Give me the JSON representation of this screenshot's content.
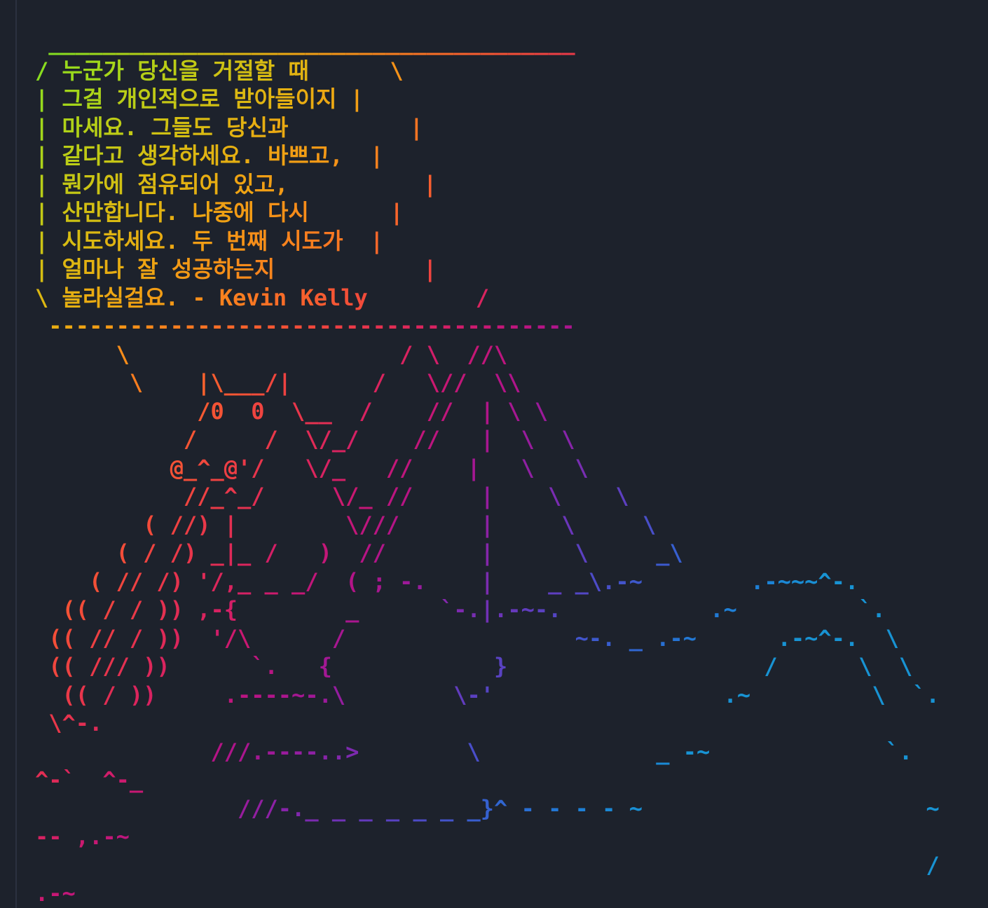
{
  "terminal": {
    "lines": [
      " _______________________________________",
      "/ 누군가 당신을 거절할 때      \\",
      "| 그걸 개인적으로 받아들이지 |",
      "| 마세요. 그들도 당신과         |",
      "| 같다고 생각하세요. 바쁘고,  |",
      "| 뭔가에 점유되어 있고,          |",
      "| 산만합니다. 나중에 다시      |",
      "| 시도하세요. 두 번째 시도가  |",
      "| 얼마나 잘 성공하는지           |",
      "\\ 놀라실걸요. - Kevin Kelly        /",
      " ---------------------------------------",
      "      \\                    / \\  //\\",
      "       \\    |\\___/|      /   \\//  \\\\",
      "            /0  0  \\__  /    //  | \\ \\",
      "           /     /  \\/_/    //   |  \\  \\",
      "          @_^_@'/   \\/_   //    |   \\   \\",
      "           //_^_/     \\/_ //     |    \\    \\",
      "        ( //) |        \\///      |     \\     \\",
      "      ( / /) _|_ /   )  //       |      \\     _\\",
      "    ( // /) '/,_ _ _/  ( ; -.    |    _ _\\.-~        .-~~~^-.",
      "  (( / / )) ,-{        _      `-.|.-~-.           .~         `.",
      " (( // / ))  '/\\      /                 ~-. _ .-~      .-~^-.  \\",
      " (( /// ))      `.   {            }                   /      \\  \\",
      "  (( / ))     .----~-.\\        \\-'                 .~         \\  `.",
      " \\^-.",
      "             ///.----..>        \\             _ -~             `.",
      "^-`  ^-_",
      "               ///-._ _ _ _ _ _ _}^ - - - - ~                     ~",
      "-- ,.-~",
      "                                                                  /",
      ".-~"
    ],
    "palette": [
      "#7ee022",
      "#9fd81b",
      "#bdcc16",
      "#d7bc12",
      "#ebaa12",
      "#f59417",
      "#f97c20",
      "#f8632c",
      "#f24b3a",
      "#e8364b",
      "#da245e",
      "#c91872",
      "#b51486",
      "#9d1999",
      "#8426ab",
      "#6a36ba",
      "#5048c6",
      "#3a5ccf",
      "#2870d4",
      "#1c83d6",
      "#1893d3"
    ]
  }
}
